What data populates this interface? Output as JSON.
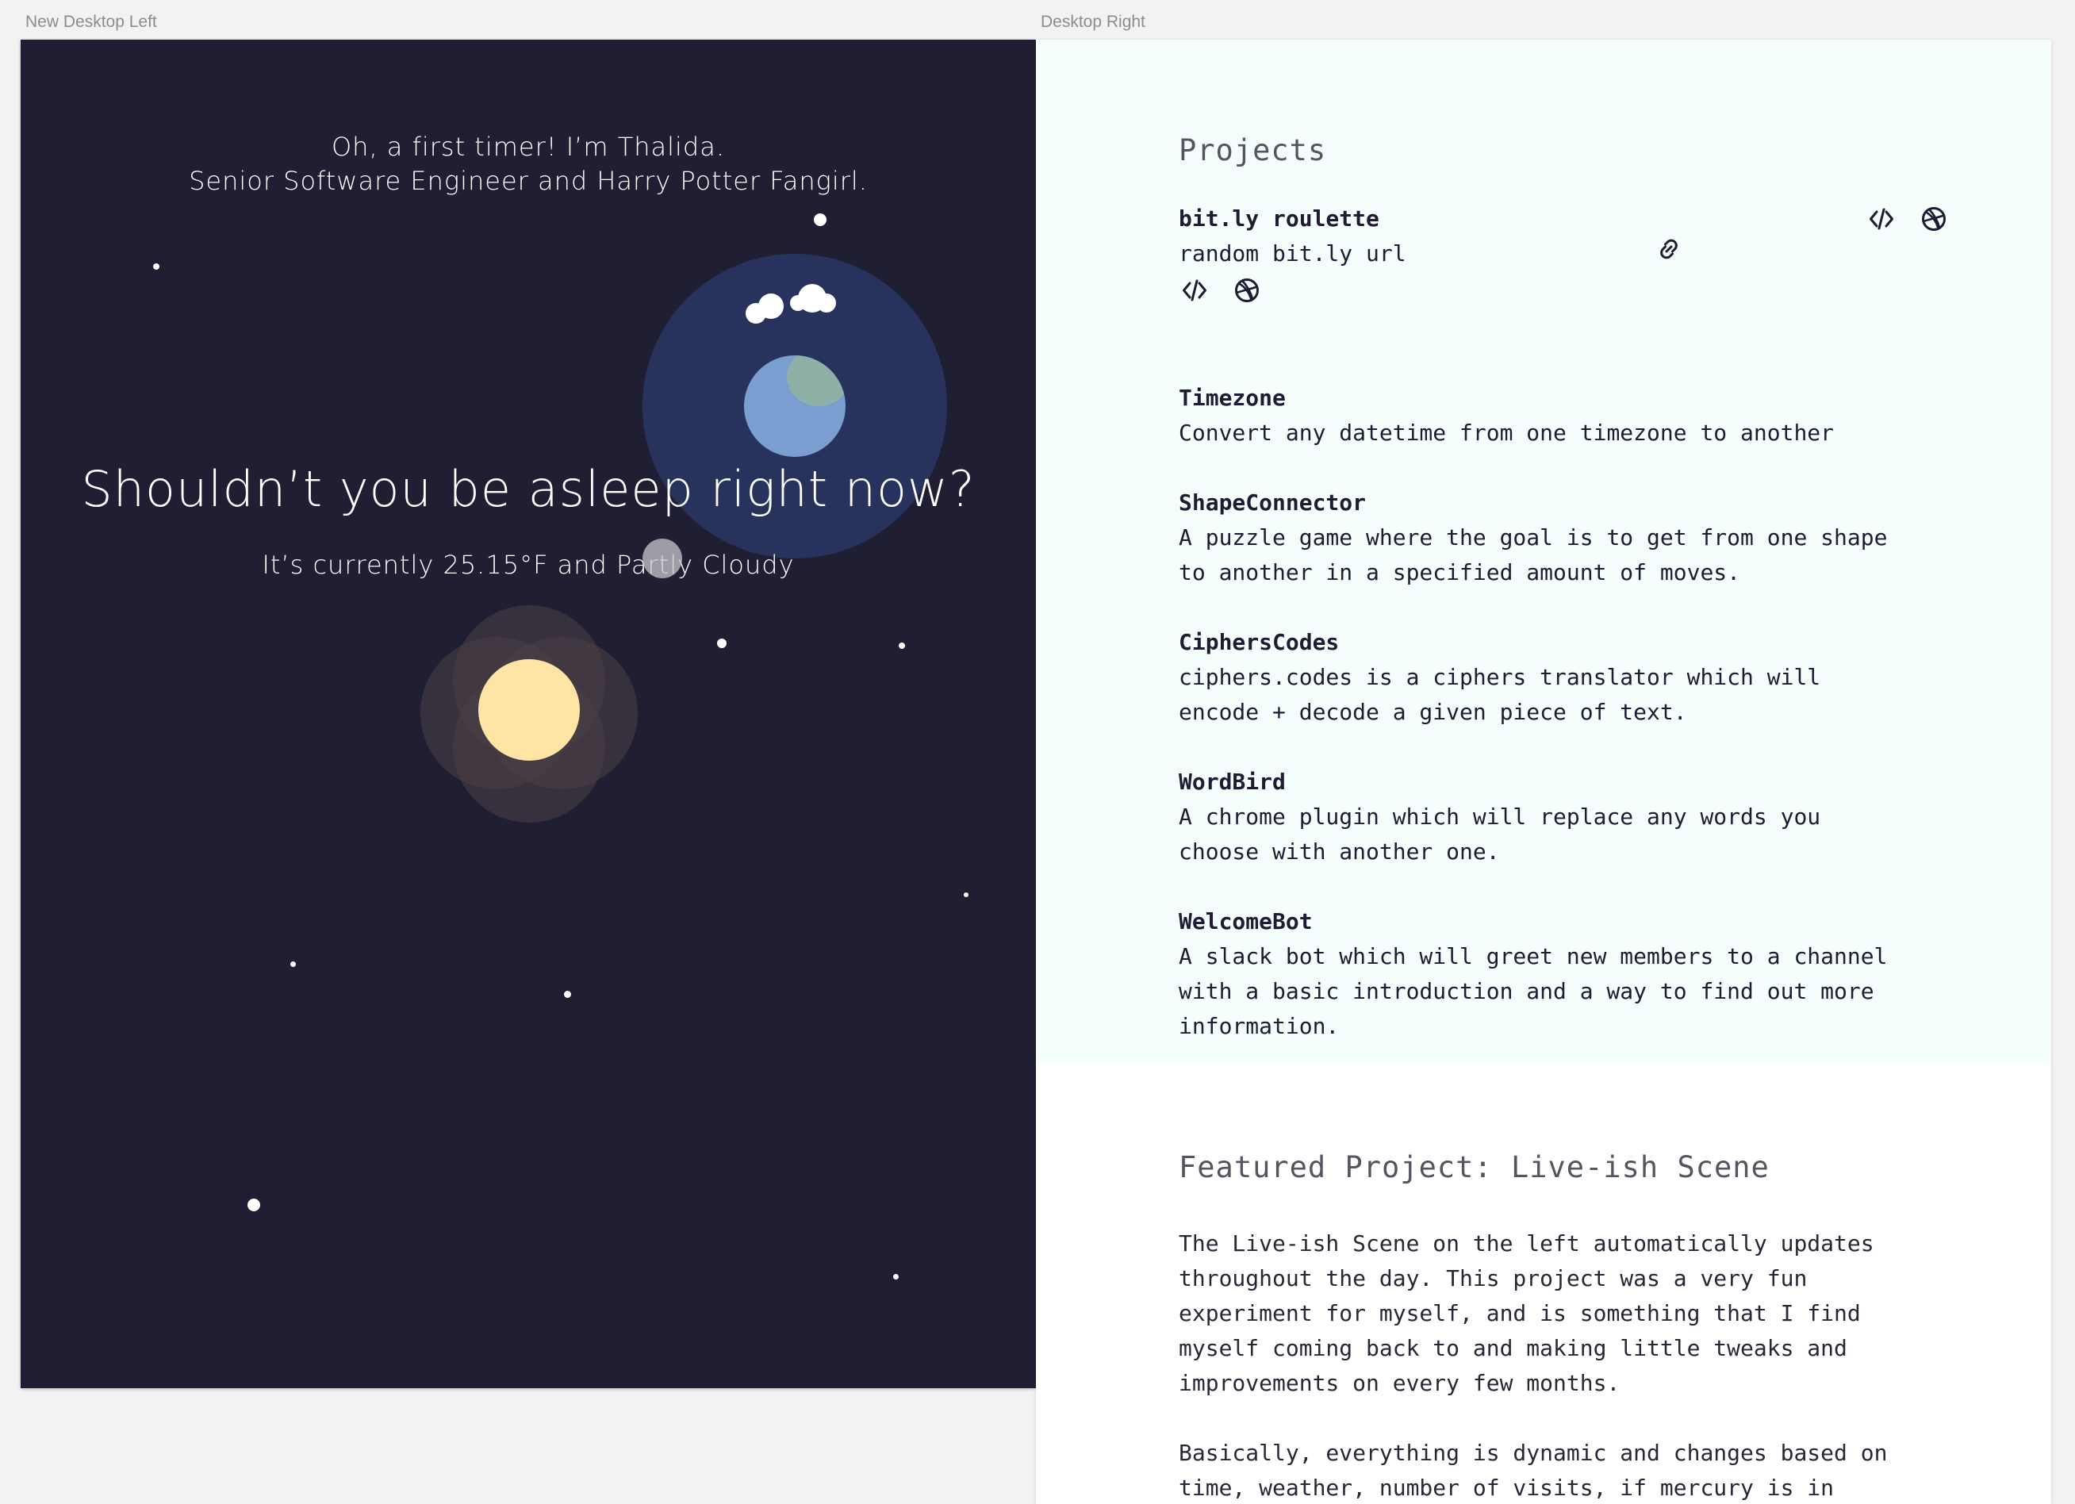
{
  "frames": {
    "left_label": "New Desktop Left",
    "right_label": "Desktop Right"
  },
  "scene": {
    "intro_line1": "Oh, a first timer! I’m Thalida.",
    "intro_line2": "Senior Software Engineer and Harry Potter Fangirl.",
    "headline": "Shouldn’t you be asleep right now?",
    "weather_text": "It’s currently 25.15°F and Partly Cloudy",
    "colors": {
      "background": "#201e33",
      "planet": "#7b9ed1",
      "moon": "#ffe4a3"
    }
  },
  "projects": {
    "title": "Projects",
    "items": [
      {
        "name": "bit.ly roulette",
        "description": "random bit.ly url",
        "icons": [
          "code-icon",
          "dribbble-icon"
        ]
      },
      {
        "name": "Timezone",
        "description": "Convert any datetime from one timezone to another"
      },
      {
        "name": "ShapeConnector",
        "description_lines": [
          "A puzzle game where the goal is to get from one shape",
          "to another in a specified amount of moves."
        ]
      },
      {
        "name": "CiphersCodes",
        "description_lines": [
          "ciphers.codes is a ciphers translator which will",
          "encode + decode a given piece of text."
        ]
      },
      {
        "name": "WordBird",
        "description_lines": [
          "A chrome plugin which will replace any words you",
          "choose with another one."
        ]
      },
      {
        "name": "WelcomeBot",
        "description_lines": [
          "A slack bot which will greet new members to a channel",
          "with a basic introduction and a way to find out more",
          "information."
        ]
      }
    ],
    "floating_icons": [
      "code-icon",
      "dribbble-icon",
      "link-icon"
    ]
  },
  "featured": {
    "title": "Featured Project: Live-ish Scene",
    "para1_lines": [
      "The Live-ish Scene on the left automatically updates",
      "throughout the day. This project was a very fun",
      "experiment for myself, and is something that I find",
      "myself coming back to and making little tweaks and",
      "improvements on every few months."
    ],
    "para2_lines": [
      "Basically, everything is dynamic and changes based on",
      "time, weather, number of visits, if mercury is in"
    ]
  }
}
